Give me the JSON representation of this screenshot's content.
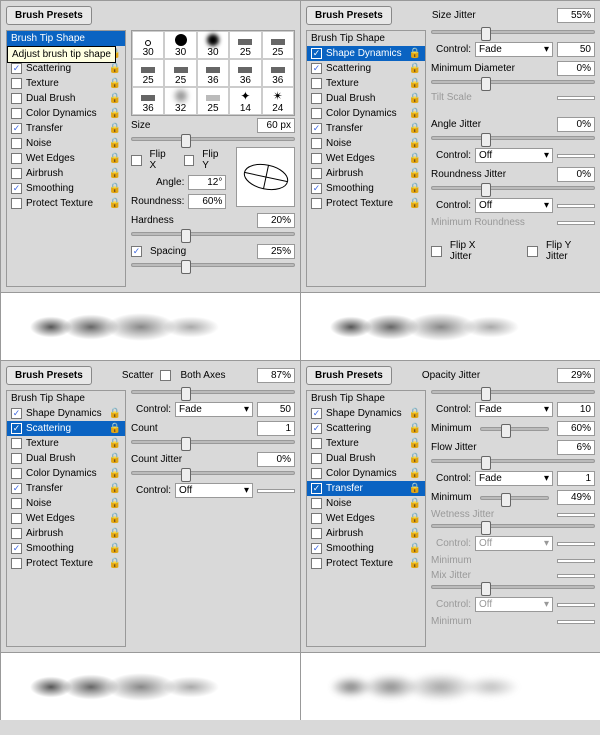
{
  "brush_presets_label": "Brush Presets",
  "tooltip": "Adjust brush tip shape",
  "sidebar_items": [
    "Brush Tip Shape",
    "Shape Dynamics",
    "Scattering",
    "Texture",
    "Dual Brush",
    "Color Dynamics",
    "Transfer",
    "Noise",
    "Wet Edges",
    "Airbrush",
    "Smoothing",
    "Protect Texture"
  ],
  "thumb_sizes": [
    "30",
    "30",
    "30",
    "25",
    "25",
    "25",
    "25",
    "36",
    "36",
    "36",
    "36",
    "32",
    "25",
    "14",
    "24"
  ],
  "p1": {
    "size_label": "Size",
    "size": "60 px",
    "flipx": "Flip X",
    "flipy": "Flip Y",
    "angle_label": "Angle:",
    "angle": "12°",
    "roundness_label": "Roundness:",
    "roundness": "60%",
    "hardness_label": "Hardness",
    "hardness": "20%",
    "spacing_label": "Spacing",
    "spacing": "25%"
  },
  "p2": {
    "sizejitter_label": "Size Jitter",
    "sizejitter": "55%",
    "control_label": "Control:",
    "control": "Fade",
    "control_val": "50",
    "mindiam_label": "Minimum Diameter",
    "mindiam": "0%",
    "tilt_label": "Tilt Scale",
    "anglejitter_label": "Angle Jitter",
    "anglejitter": "0%",
    "control2": "Off",
    "roundjitter_label": "Roundness Jitter",
    "roundjitter": "0%",
    "control3": "Off",
    "minround_label": "Minimum Roundness",
    "flipxj": "Flip X Jitter",
    "flipyj": "Flip Y Jitter"
  },
  "p3": {
    "scatter_label": "Scatter",
    "bothaxes": "Both Axes",
    "scatter": "87%",
    "control": "Fade",
    "control_val": "50",
    "count_label": "Count",
    "count": "1",
    "countjitter_label": "Count Jitter",
    "countjitter": "0%",
    "control2": "Off",
    "control_label": "Control:"
  },
  "p4": {
    "opjitter_label": "Opacity Jitter",
    "opjitter": "29%",
    "control": "Fade",
    "control_val": "10",
    "control_label": "Control:",
    "min_label": "Minimum",
    "min": "60%",
    "flowjitter_label": "Flow Jitter",
    "flowjitter": "6%",
    "control2": "Fade",
    "control2_val": "1",
    "min2": "49%",
    "wet_label": "Wetness Jitter",
    "controloff": "Off",
    "mix_label": "Mix Jitter"
  }
}
